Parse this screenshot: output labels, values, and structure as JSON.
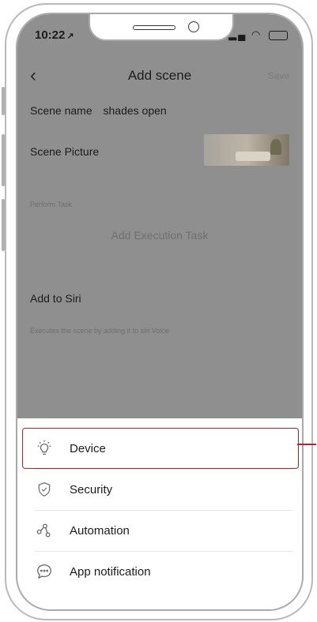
{
  "status_bar": {
    "time": "10:22",
    "location_arrow": "↗"
  },
  "nav": {
    "back_icon": "chevron-left-icon",
    "title": "Add scene",
    "save_label": "Save"
  },
  "form": {
    "scene_name_label": "Scene name",
    "scene_name_value": "shades open",
    "scene_picture_label": "Scene Picture",
    "perform_task_label": "Perform Task",
    "add_execution_task": "Add Execution Task",
    "add_to_siri_label": "Add to Siri",
    "siri_hint": "Executes the scene by adding it to siri Voice"
  },
  "sheet": {
    "items": [
      {
        "label": "Device",
        "icon": "lightbulb-icon",
        "highlighted": true
      },
      {
        "label": "Security",
        "icon": "shield-check-icon",
        "highlighted": false
      },
      {
        "label": "Automation",
        "icon": "automation-nodes-icon",
        "highlighted": false
      },
      {
        "label": "App notification",
        "icon": "chat-bubble-icon",
        "highlighted": false
      }
    ]
  },
  "colors": {
    "highlight": "#b8202f",
    "overlay": "#8f8f8f"
  }
}
